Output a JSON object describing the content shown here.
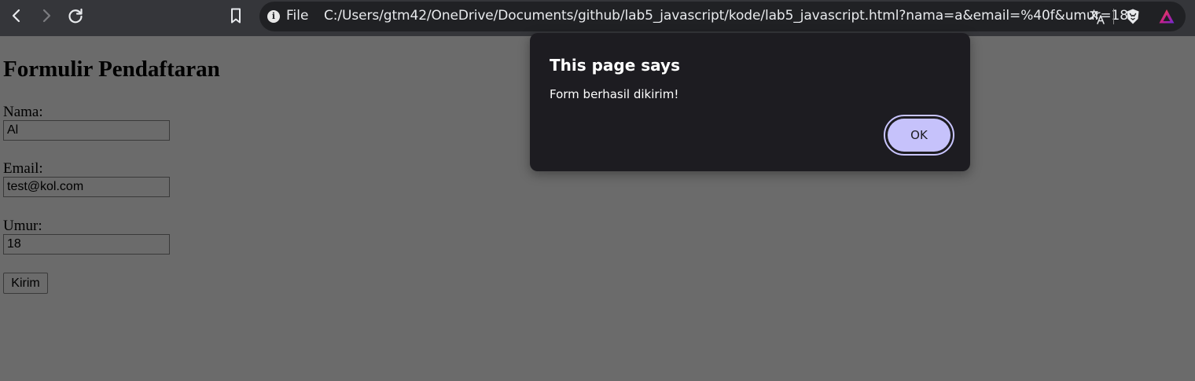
{
  "browser": {
    "scheme_label": "File",
    "url": "C:/Users/gtm42/OneDrive/Documents/github/lab5_javascript/kode/lab5_javascript.html?nama=a&email=%40f&umur=18",
    "icons": [
      "back-arrow-icon",
      "forward-arrow-icon",
      "reload-icon",
      "bookmark-icon",
      "info-icon",
      "translate-icon",
      "brave-shield-icon",
      "brave-rewards-icon"
    ]
  },
  "form": {
    "title": "Formulir Pendaftaran",
    "fields": [
      {
        "label": "Nama:",
        "value": "Al"
      },
      {
        "label": "Email:",
        "value": "test@kol.com"
      },
      {
        "label": "Umur:",
        "value": "18"
      }
    ],
    "submit_label": "Kirim"
  },
  "dialog": {
    "title": "This page says",
    "message": "Form berhasil dikirim!",
    "ok_label": "OK"
  },
  "colors": {
    "toolbar": "#35363a",
    "omnibox": "#202124",
    "page_dimmed": "#6b6b6b",
    "dialog_bg": "#1d1c21",
    "ok_button": "#c6c2fb"
  }
}
